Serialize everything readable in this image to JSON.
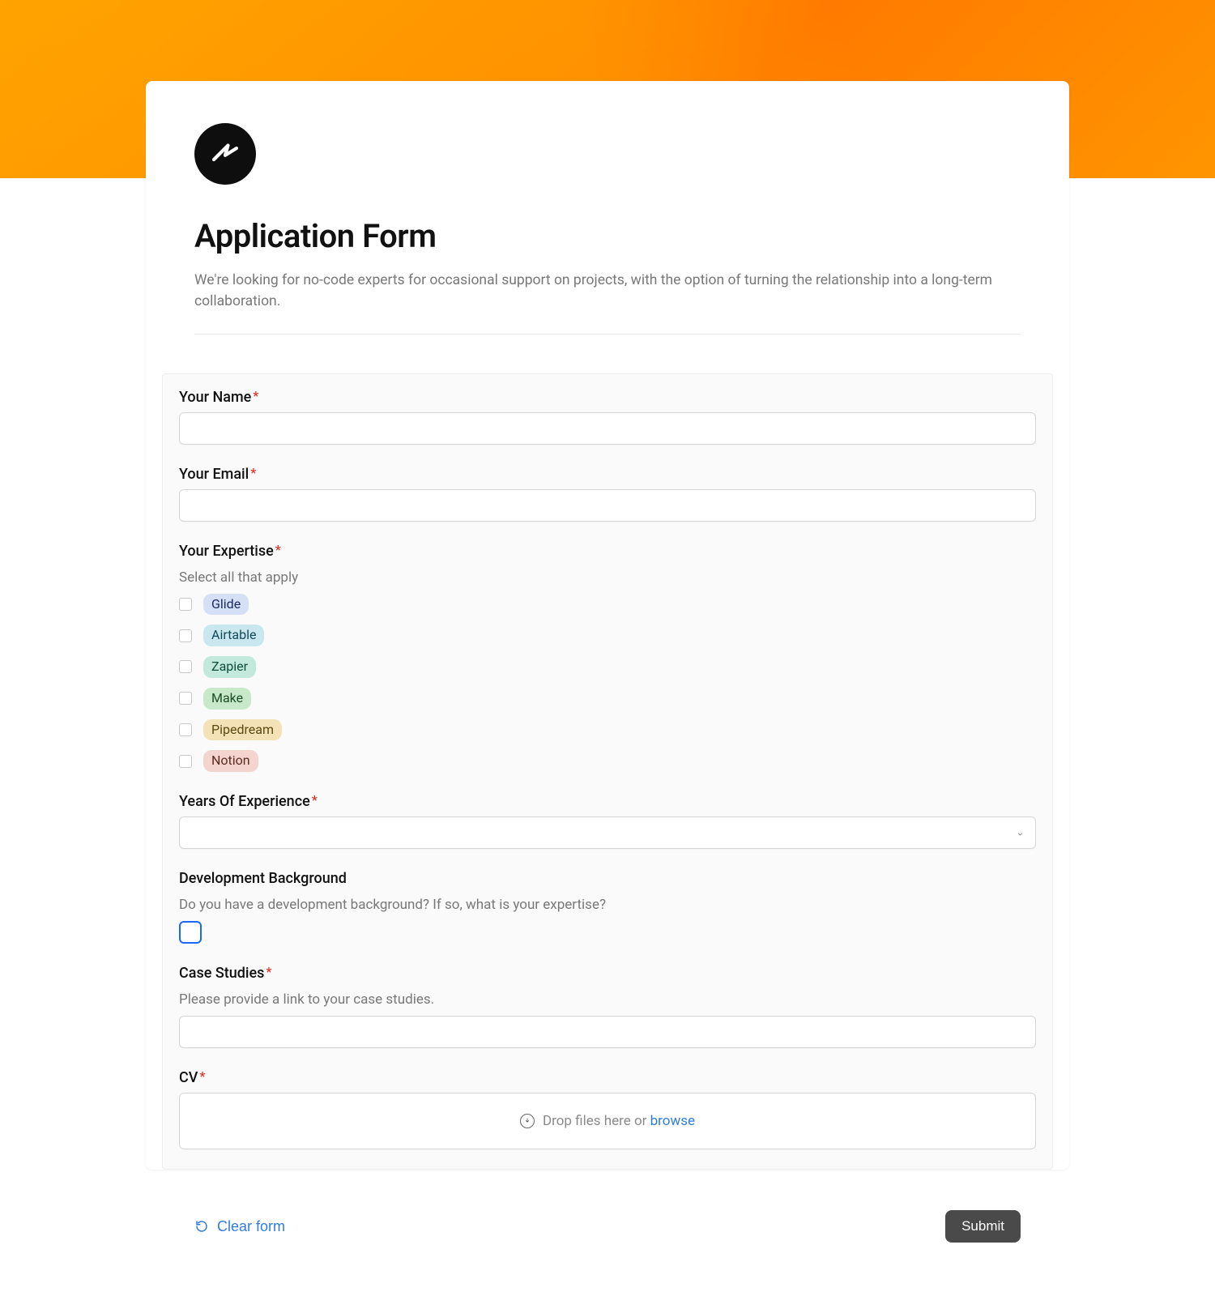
{
  "header": {
    "title": "Application Form",
    "subtitle": "We're looking for no-code experts for occasional support on projects, with the option of turning the relationship into a long-term collaboration."
  },
  "fields": {
    "name": {
      "label": "Your Name",
      "value": ""
    },
    "email": {
      "label": "Your Email",
      "value": ""
    },
    "expertise": {
      "label": "Your Expertise",
      "hint": "Select all that apply",
      "options": [
        {
          "label": "Glide",
          "tagClass": "tag-blue"
        },
        {
          "label": "Airtable",
          "tagClass": "tag-cyan"
        },
        {
          "label": "Zapier",
          "tagClass": "tag-teal"
        },
        {
          "label": "Make",
          "tagClass": "tag-green"
        },
        {
          "label": "Pipedream",
          "tagClass": "tag-amber"
        },
        {
          "label": "Notion",
          "tagClass": "tag-pink"
        }
      ]
    },
    "years": {
      "label": "Years Of Experience",
      "value": ""
    },
    "dev": {
      "label": "Development Background",
      "hint": "Do you have a development background? If so, what is your expertise?"
    },
    "cases": {
      "label": "Case Studies",
      "hint": "Please provide a link to your case studies.",
      "value": ""
    },
    "cv": {
      "label": "CV",
      "dropText": "Drop files here or ",
      "browseText": "browse"
    }
  },
  "footer": {
    "clear_label": "Clear form",
    "submit_label": "Submit"
  }
}
